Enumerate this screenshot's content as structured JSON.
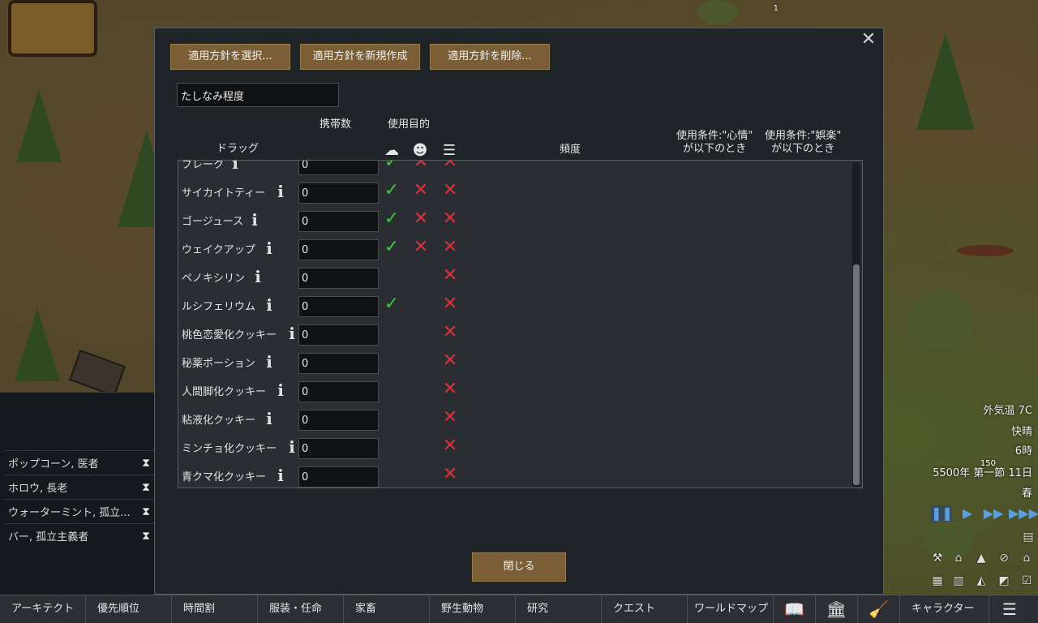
{
  "dialog": {
    "buttons": {
      "select": "適用方針を選択...",
      "create": "適用方針を新規作成",
      "delete": "適用方針を削除..."
    },
    "policy_name": "たしなみ程度",
    "headers": {
      "drug": "ドラッグ",
      "carry": "携帯数",
      "purpose": "使用目的",
      "frequency": "頻度",
      "cond_mood": "使用条件:\"心情\"",
      "cond_mood_2": "が以下のとき",
      "cond_joy": "使用条件:\"娯楽\"",
      "cond_joy_2": "が以下のとき"
    },
    "close": "閉じる",
    "close_icon": "close-icon",
    "rows": [
      {
        "name": "ブレーク",
        "qty": "0",
        "addiction": "check",
        "joy": "cross",
        "schedule": "cross"
      },
      {
        "name": "サイカイトティー",
        "qty": "0",
        "addiction": "check",
        "joy": "cross",
        "schedule": "cross"
      },
      {
        "name": "ゴージュース",
        "qty": "0",
        "addiction": "check",
        "joy": "cross",
        "schedule": "cross"
      },
      {
        "name": "ウェイクアップ",
        "qty": "0",
        "addiction": "check",
        "joy": "cross",
        "schedule": "cross"
      },
      {
        "name": "ペノキシリン",
        "qty": "0",
        "addiction": "",
        "joy": "",
        "schedule": "cross"
      },
      {
        "name": "ルシフェリウム",
        "qty": "0",
        "addiction": "check",
        "joy": "",
        "schedule": "cross"
      },
      {
        "name": "桃色恋愛化クッキー",
        "qty": "0",
        "addiction": "",
        "joy": "",
        "schedule": "cross"
      },
      {
        "name": "秘薬ポーション",
        "qty": "0",
        "addiction": "",
        "joy": "",
        "schedule": "cross"
      },
      {
        "name": "人間脚化クッキー",
        "qty": "0",
        "addiction": "",
        "joy": "",
        "schedule": "cross"
      },
      {
        "name": "粘液化クッキー",
        "qty": "0",
        "addiction": "",
        "joy": "",
        "schedule": "cross"
      },
      {
        "name": "ミンチョ化クッキー",
        "qty": "0",
        "addiction": "",
        "joy": "",
        "schedule": "cross"
      },
      {
        "name": "青クマ化クッキー",
        "qty": "0",
        "addiction": "",
        "joy": "",
        "schedule": "cross"
      }
    ],
    "marks": {
      "check": "✓",
      "cross": "✕"
    }
  },
  "colonists": [
    {
      "label": "ポップコーン, 医者"
    },
    {
      "label": "ホロウ, 長老"
    },
    {
      "label": "ウォーターミント, 孤立..."
    },
    {
      "label": "バー, 孤立主義者"
    }
  ],
  "hud": {
    "temperature": "外気温 7C",
    "weather": "快晴",
    "time": "6時",
    "date": "5500年 第一節 11日",
    "season": "春",
    "marker_count": "1",
    "marker_value": "150"
  },
  "bottom_bar": {
    "architect": "アーキテクト",
    "priority": "優先順位",
    "schedule": "時間割",
    "assign": "服装・任命",
    "animals": "家畜",
    "wildlife": "野生動物",
    "research": "研究",
    "quests": "クエスト",
    "world_map": "ワールドマップ",
    "characters": "キャラクター"
  },
  "colors": {
    "check": "#3ec43e",
    "cross": "#d8323a",
    "button": "#7a5f36",
    "panel": "#1f2428"
  }
}
